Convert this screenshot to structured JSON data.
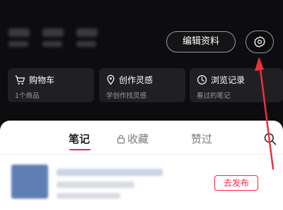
{
  "profile": {
    "edit_profile_label": "编辑资料"
  },
  "quick_cards": [
    {
      "title": "购物车",
      "subtitle": "1个商品",
      "icon": "cart-icon"
    },
    {
      "title": "创作灵感",
      "subtitle": "学创作找灵感",
      "icon": "lightbulb-pin-icon"
    },
    {
      "title": "浏览记录",
      "subtitle": "看过的笔记",
      "icon": "clock-icon"
    }
  ],
  "tabs": [
    {
      "label": "笔记",
      "active": true
    },
    {
      "label": "收藏",
      "locked": true
    },
    {
      "label": "赞过"
    }
  ],
  "note_item": {
    "publish_label": "去发布"
  },
  "colors": {
    "accent": "#ff2442",
    "annotation_arrow": "#e8323c"
  }
}
